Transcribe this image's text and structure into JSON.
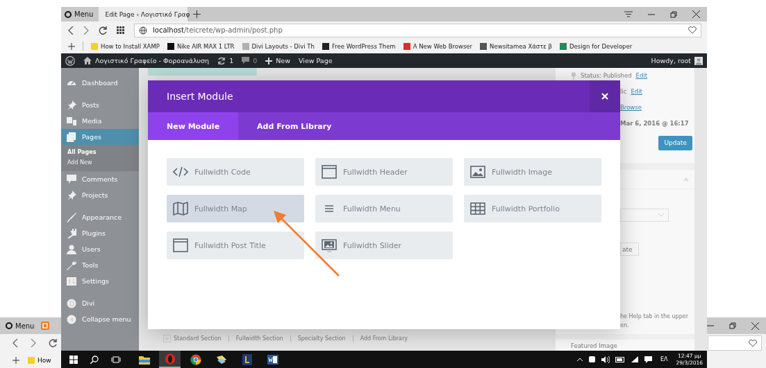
{
  "back_window": {
    "menu_label": "Menu",
    "bookmark": "How"
  },
  "browser": {
    "menu_label": "Menu",
    "tabs": [
      {
        "title": "Edit Page ‹ Λογιστικό Γραφ",
        "selected": true
      }
    ],
    "address": {
      "host": "localhost",
      "path": "/teicrete/wp-admin/post.php"
    },
    "bookmarks": [
      {
        "label": "How to Install XAMP",
        "color": "#f3d31c"
      },
      {
        "label": "Nike AIR MAX 1 LTR",
        "color": "#111111"
      },
      {
        "label": "Divi Layouts - Divi Th",
        "color": "#b0b0b0"
      },
      {
        "label": "Free WordPress Them",
        "color": "#222222"
      },
      {
        "label": "A New Web Browser",
        "color": "#d9302c"
      },
      {
        "label": "Newsitamea Χάστε β",
        "color": "#555555"
      },
      {
        "label": "Design for Developer",
        "color": "#1f8a5a"
      }
    ]
  },
  "admin_bar": {
    "site_name": "Λογιστικό Γραφείο - Φοροανάλυση",
    "updates": "1",
    "comments": "0",
    "new_label": "New",
    "view_label": "View Page",
    "greeting": "Howdy, root"
  },
  "sidebar": {
    "groups": [
      [
        {
          "label": "Dashboard",
          "kind": "gauge",
          "selected": false
        }
      ],
      [
        {
          "label": "Posts",
          "kind": "pin",
          "selected": false
        },
        {
          "label": "Media",
          "kind": "media",
          "selected": false
        },
        {
          "label": "Pages",
          "kind": "pages",
          "selected": true,
          "children": [
            {
              "label": "All Pages",
              "selected": true
            },
            {
              "label": "Add New",
              "selected": false
            }
          ]
        },
        {
          "label": "Comments",
          "kind": "comment",
          "selected": false
        },
        {
          "label": "Projects",
          "kind": "pin",
          "selected": false
        }
      ],
      [
        {
          "label": "Appearance",
          "kind": "brush",
          "selected": false
        },
        {
          "label": "Plugins",
          "kind": "plug",
          "selected": false
        },
        {
          "label": "Users",
          "kind": "user",
          "selected": false
        },
        {
          "label": "Tools",
          "kind": "wrench",
          "selected": false
        },
        {
          "label": "Settings",
          "kind": "settings",
          "selected": false
        }
      ],
      [
        {
          "label": "Divi",
          "kind": "divi",
          "selected": false
        },
        {
          "label": "Collapse menu",
          "kind": "collapse",
          "selected": false
        }
      ]
    ]
  },
  "section_links": [
    "Standard Section",
    "Fullwidth Section",
    "Specialty Section",
    "Add From Library"
  ],
  "publish_box": {
    "status": "Status: Published",
    "status_link": "Edit",
    "visibility": "lic",
    "visibility_link": "Edit",
    "revisions_link": "Browse",
    "date": "Mar 6, 2016 @ 16:17",
    "update_button": "Update",
    "template_fragment": "ate",
    "help_lines": [
      "he Help tab in the upper",
      "en."
    ],
    "featured_image": "Featured Image"
  },
  "modal": {
    "title": "Insert Module",
    "tabs": [
      {
        "label": "New Module",
        "selected": true
      },
      {
        "label": "Add From Library",
        "selected": false
      }
    ],
    "modules": [
      {
        "label": "Fullwidth Code",
        "kind": "code",
        "hovered": false
      },
      {
        "label": "Fullwidth Header",
        "kind": "header",
        "hovered": false
      },
      {
        "label": "Fullwidth Image",
        "kind": "image",
        "hovered": false
      },
      {
        "label": "Fullwidth Map",
        "kind": "map",
        "hovered": true
      },
      {
        "label": "Fullwidth Menu",
        "kind": "menu",
        "hovered": false
      },
      {
        "label": "Fullwidth Portfolio",
        "kind": "portfolio",
        "hovered": false
      },
      {
        "label": "Fullwidth Post Title",
        "kind": "post_title",
        "hovered": false
      },
      {
        "label": "Fullwidth Slider",
        "kind": "slider",
        "hovered": false
      }
    ]
  },
  "taskbar": {
    "apps": [
      {
        "kind": "explorer",
        "active": false
      },
      {
        "kind": "opera",
        "active": true
      },
      {
        "kind": "chrome",
        "active": false
      },
      {
        "kind": "folder",
        "active": false
      },
      {
        "kind": "game",
        "active": false
      },
      {
        "kind": "word",
        "active": false
      }
    ],
    "language": "ΕΛ",
    "time": "12:47 μμ",
    "date": "29/3/2016"
  }
}
